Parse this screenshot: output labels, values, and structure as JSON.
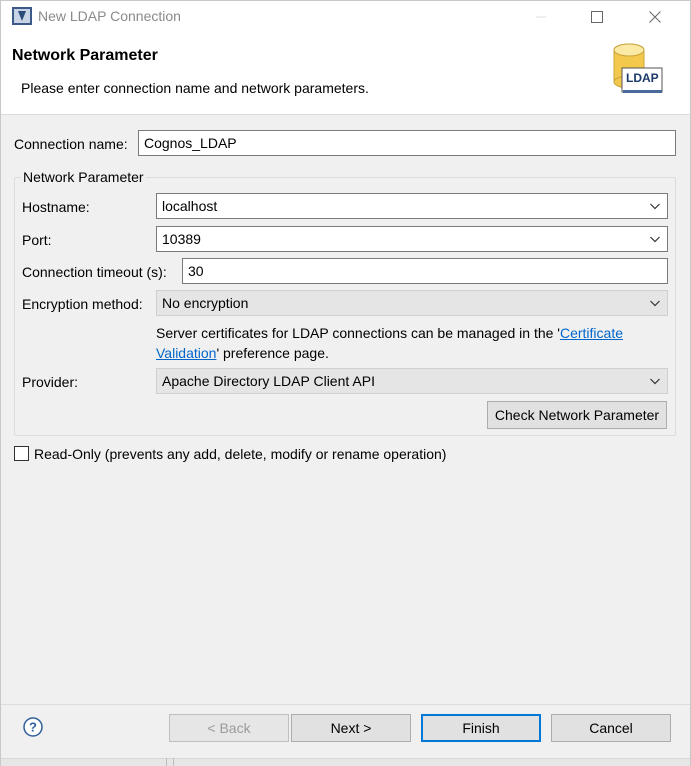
{
  "window": {
    "title": "New LDAP Connection"
  },
  "banner": {
    "title": "Network Parameter",
    "description": "Please enter connection name and network parameters.",
    "icon_label": "LDAP"
  },
  "form": {
    "connection_name_label": "Connection name:",
    "connection_name_value": "Cognos_LDAP",
    "group_legend": "Network Parameter",
    "hostname_label": "Hostname:",
    "hostname_value": "localhost",
    "port_label": "Port:",
    "port_value": "10389",
    "timeout_label": "Connection timeout (s):",
    "timeout_value": "30",
    "encryption_label": "Encryption method:",
    "encryption_value": "No encryption",
    "note_prefix": "Server certificates for LDAP connections can be managed in the '",
    "note_link": "Certificate Validation",
    "note_suffix": "' preference page.",
    "provider_label": "Provider:",
    "provider_value": "Apache Directory LDAP Client API",
    "check_button": "Check Network Parameter",
    "readonly_label": "Read-Only (prevents any add, delete, modify or rename operation)",
    "readonly_checked": false
  },
  "footer": {
    "back": "< Back",
    "next": "Next >",
    "finish": "Finish",
    "cancel": "Cancel",
    "help_icon": "question-mark"
  },
  "colors": {
    "link": "#0066cc",
    "default_button_border": "#0078d7",
    "ldap_cylinder": "#f2c94c"
  }
}
